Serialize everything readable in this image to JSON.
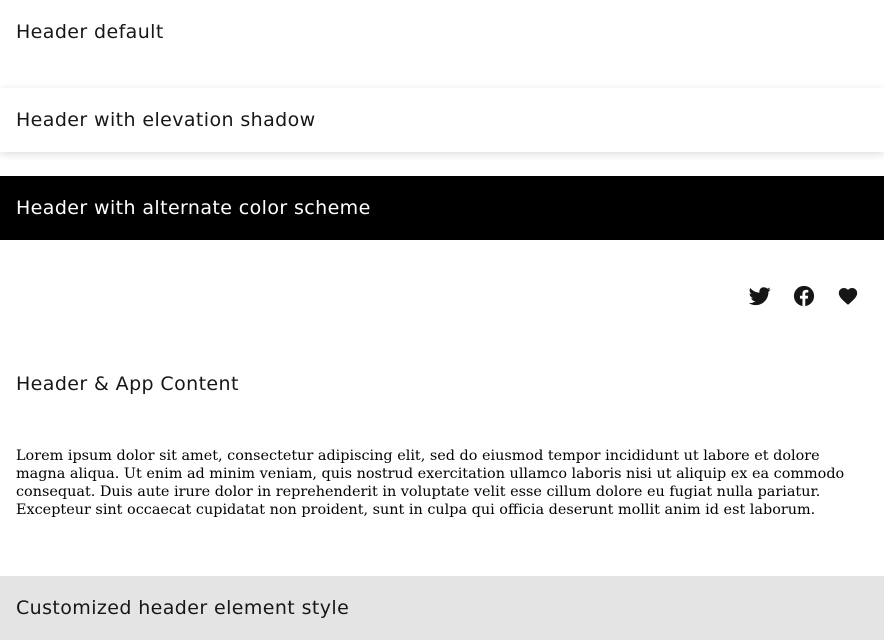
{
  "headers": {
    "default_title": "Header default",
    "elevated_title": "Header with elevation shadow",
    "alternate_title": "Header with alternate color scheme",
    "app_title": "Header & App Content",
    "custom_title": "Customized header element style"
  },
  "actions": {
    "icons": [
      "twitter-icon",
      "facebook-icon",
      "heart-icon"
    ]
  },
  "content": {
    "body": "Lorem ipsum dolor sit amet, consectetur adipiscing elit, sed do eiusmod tempor incididunt ut labore et dolore magna aliqua. Ut enim ad minim veniam, quis nostrud exercitation ullamco laboris nisi ut aliquip ex ea commodo consequat. Duis aute irure dolor in reprehenderit in voluptate velit esse cillum dolore eu fugiat nulla pariatur. Excepteur sint occaecat cupidatat non proident, sunt in culpa qui officia deserunt mollit anim id est laborum."
  },
  "colors": {
    "alternate_background": "#000000",
    "alternate_text": "#ffffff",
    "custom_background": "#e4e4e4",
    "text": "#161616"
  }
}
